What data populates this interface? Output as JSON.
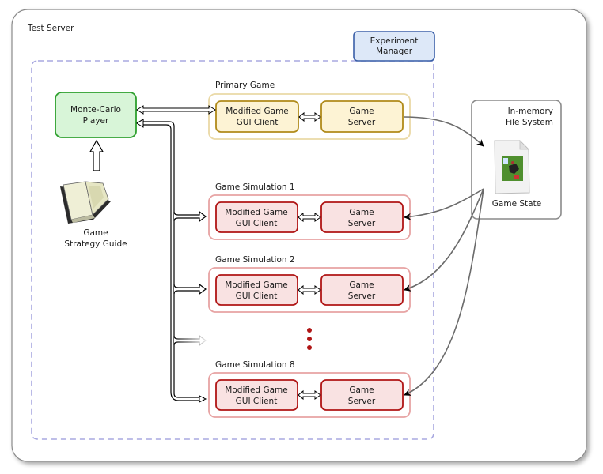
{
  "server": {
    "title": "Test Server"
  },
  "experiment_manager": {
    "line1": "Experiment",
    "line2": "Manager"
  },
  "player": {
    "line1": "Monte-Carlo",
    "line2": "Player"
  },
  "guide": {
    "line1": "Game",
    "line2": "Strategy Guide",
    "icon": "book-icon"
  },
  "filesystem": {
    "line1": "In-memory",
    "line2": "File System",
    "file_label": "Game State",
    "icon": "document-image-icon"
  },
  "games": [
    {
      "title": "Primary Game",
      "client_line1": "Modified Game",
      "client_line2": "GUI Client",
      "server_line1": "Game",
      "server_line2": "Server",
      "kind": "primary"
    },
    {
      "title": "Game Simulation 1",
      "client_line1": "Modified Game",
      "client_line2": "GUI Client",
      "server_line1": "Game",
      "server_line2": "Server",
      "kind": "simulation"
    },
    {
      "title": "Game Simulation 2",
      "client_line1": "Modified Game",
      "client_line2": "GUI Client",
      "server_line1": "Game",
      "server_line2": "Server",
      "kind": "simulation"
    },
    {
      "title": "Game Simulation 8",
      "client_line1": "Modified Game",
      "client_line2": "GUI Client",
      "server_line1": "Game",
      "server_line2": "Server",
      "kind": "simulation"
    }
  ],
  "colors": {
    "manager_fill": "#dde8f8",
    "manager_stroke": "#3a5fa8",
    "player_fill": "#d8f5d8",
    "player_stroke": "#2ea02e",
    "primary_outer": "#ead9a6",
    "primary_fill": "#fdf3d4",
    "primary_stroke": "#b08a1a",
    "sim_outer": "#e7a3a3",
    "sim_fill": "#f9e2e2",
    "sim_stroke": "#b01515",
    "dashed": "#a8a8e0",
    "ellipsis": "#b01515"
  }
}
